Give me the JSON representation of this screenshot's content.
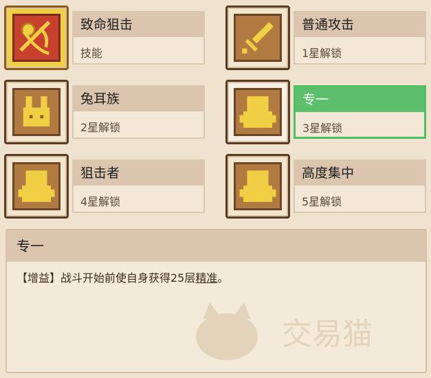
{
  "skills": [
    {
      "title": "致命狙击",
      "sub": "技能",
      "icon": "crossed-arrows-icon"
    },
    {
      "title": "普通攻击",
      "sub": "1星解锁",
      "icon": "sword-icon"
    },
    {
      "title": "兔耳族",
      "sub": "2星解锁",
      "icon": "rabbit-icon"
    },
    {
      "title": "专一",
      "sub": "3星解锁",
      "icon": "bear-icon"
    },
    {
      "title": "狙击者",
      "sub": "4星解锁",
      "icon": "bear-icon"
    },
    {
      "title": "高度集中",
      "sub": "5星解锁",
      "icon": "bear-icon"
    }
  ],
  "detail": {
    "title": "专一",
    "prefix": "【增益】战斗开始前使自身获得25层",
    "highlight": "精准",
    "suffix": "。"
  },
  "watermark": "交易猫",
  "colors": {
    "active": "#4fbf62",
    "background": "#efe3cf"
  }
}
